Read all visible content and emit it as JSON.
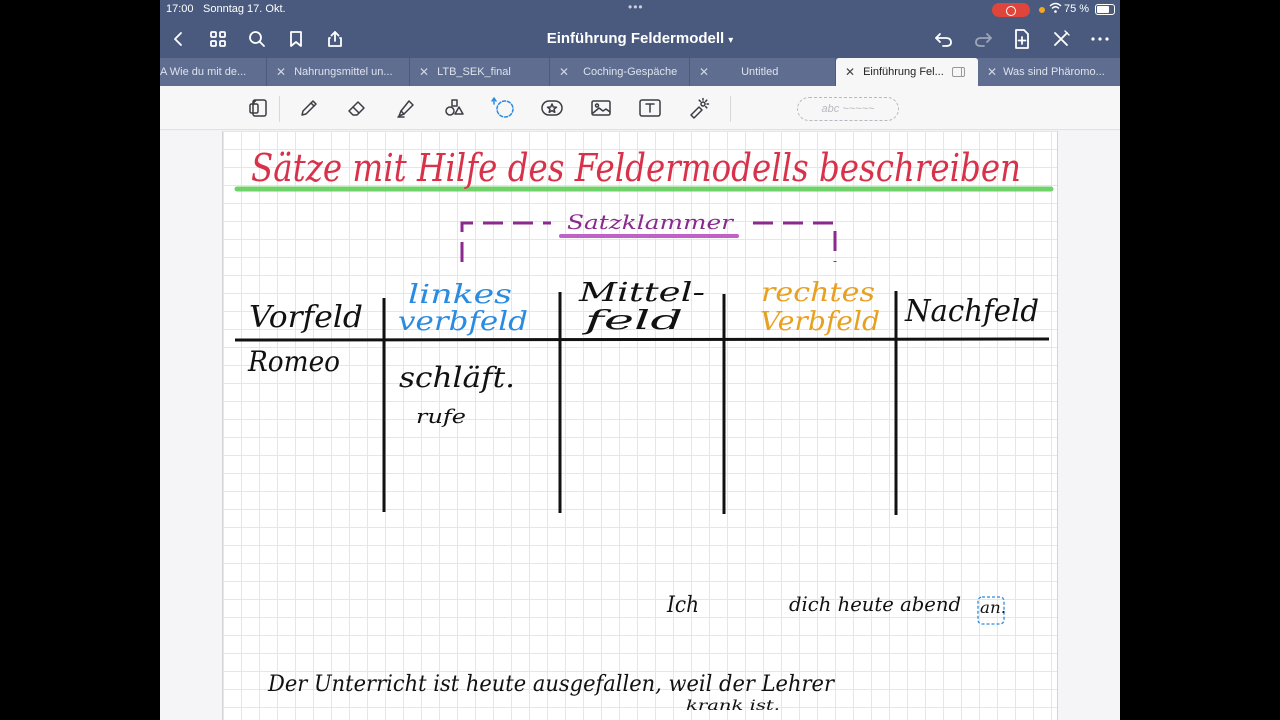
{
  "status_bar": {
    "time": "17:00",
    "date": "Sonntag 17. Okt.",
    "battery": "75 %",
    "battery_level": 0.75
  },
  "nav": {
    "title": "Einführung Feldermodell",
    "title_chevron": "⌄"
  },
  "tabs": [
    {
      "label": "A Wie du mit de...",
      "active": false
    },
    {
      "label": "Nahrungsmittel un...",
      "active": false
    },
    {
      "label": "LTB_SEK_final",
      "active": false
    },
    {
      "label": "Coching-Gespäche",
      "active": false
    },
    {
      "label": "Untitled",
      "active": false
    },
    {
      "label": "Einführung Fel...",
      "active": true
    },
    {
      "label": "Was sind Phäromo...",
      "active": false
    }
  ],
  "toolbar": {
    "shape_placeholder": "abc ~~~~~"
  },
  "note": {
    "title": "Sätze mit Hilfe des Feldermodells beschreiben",
    "bracket_label": "Satzklammer",
    "columns": [
      "Vorfeld",
      "linkes verbfeld",
      "Mittel-feld",
      "rechtes Verbfeld",
      "Nachfeld"
    ],
    "col2_line1": "linkes",
    "col2_line2": "verbfeld",
    "col3_line1": "Mittel-",
    "col3_line2": "feld",
    "col4_line1": "rechtes",
    "col4_line2": "Verbfeld",
    "row_vorfeld": "Romeo",
    "row_linkes_1": "schläft.",
    "row_linkes_2": "rufe",
    "sentence2_subject": "Ich",
    "sentence2_rest": "dich heute abend",
    "sentence2_particle": "an.",
    "sentence3_line1": "Der Unterricht ist heute ausgefallen, weil der Lehrer",
    "sentence3_line2": "krank ist."
  },
  "colors": {
    "title": "#d8324a",
    "highlight": "#6fd36a",
    "bracket": "#8a2a8f",
    "left_verb": "#2a8be0",
    "right_verb": "#e8a020",
    "ink": "#111111"
  }
}
